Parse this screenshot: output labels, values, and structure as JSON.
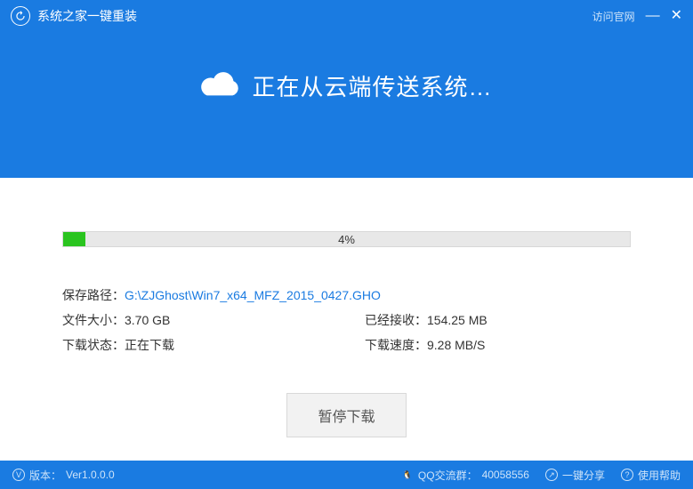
{
  "titlebar": {
    "app_title": "系统之家一键重装",
    "visit_official": "访问官网",
    "minimize": "—",
    "close": "✕"
  },
  "hero": {
    "text": "正在从云端传送系统…"
  },
  "progress": {
    "percent": 4,
    "percent_label": "4%"
  },
  "details": {
    "path_label": "保存路径：",
    "path_value": "G:\\ZJGhost\\Win7_x64_MFZ_2015_0427.GHO",
    "filesize_label": "文件大小：",
    "filesize_value": "3.70 GB",
    "received_label": "已经接收：",
    "received_value": "154.25 MB",
    "status_label": "下载状态：",
    "status_value": "正在下载",
    "speed_label": "下载速度：",
    "speed_value": "9.28 MB/S"
  },
  "action": {
    "pause_label": "暂停下载"
  },
  "footer": {
    "version_label": "版本：",
    "version_value": "Ver1.0.0.0",
    "qq_label": "QQ交流群：",
    "qq_value": "40058556",
    "share_label": "一键分享",
    "help_label": "使用帮助"
  },
  "colors": {
    "primary": "#1a7be1",
    "progress": "#2ac41f"
  }
}
